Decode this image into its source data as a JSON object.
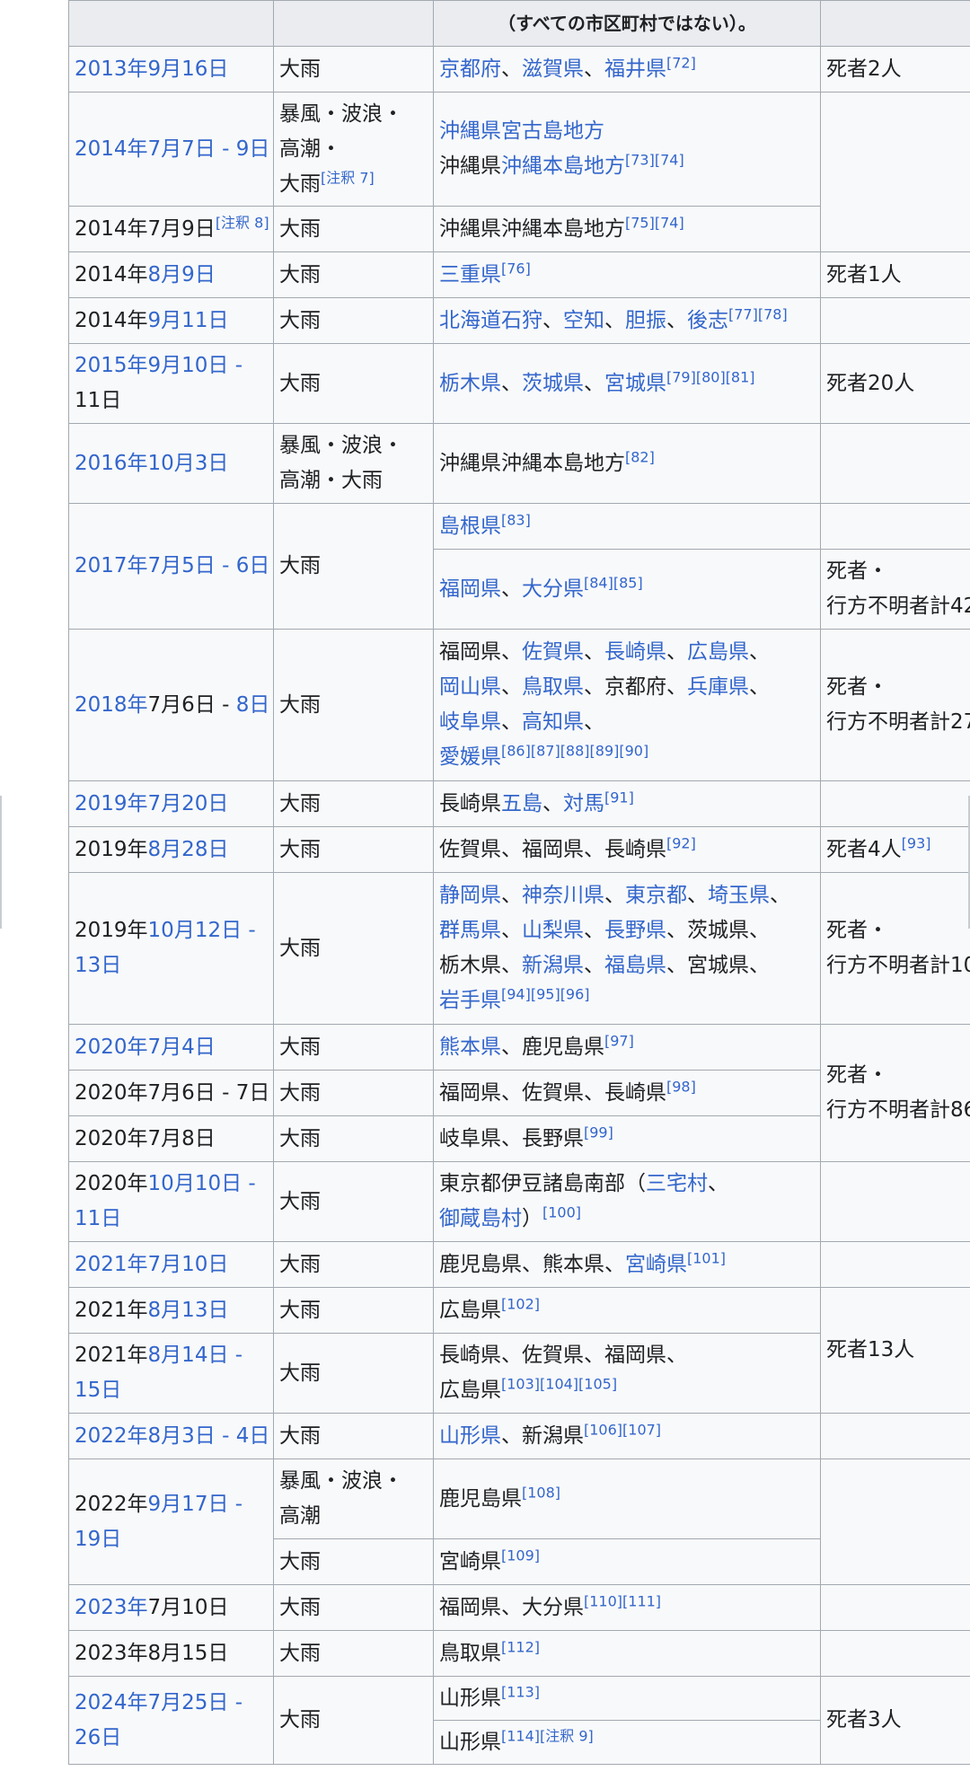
{
  "header_note": "（すべての市区町村ではない）。",
  "rows": {
    "r1": {
      "date_a": "2013年9月16日",
      "type": "大雨",
      "area_a": "京都府",
      "sep1": "、",
      "area_b": "滋賀県",
      "sep2": "、",
      "area_c": "福井県",
      "ref": "[72]",
      "damage": "死者2人"
    },
    "r2": {
      "date_a": "2014年7月7日",
      "sep": " - ",
      "date_b": "9日",
      "type_a": "暴風・波浪・",
      "type_b": "高潮・",
      "type_c": "大雨",
      "type_ref": "[注釈 7]",
      "area_a": "沖縄県宮古島地方",
      "area_b_plain": "沖縄県",
      "area_b_link": "沖縄本島地方",
      "ref": "[73][74]"
    },
    "r3": {
      "date": "2014年7月9日",
      "date_ref": "[注釈 8]",
      "type": "大雨",
      "area": "沖縄県沖縄本島地方",
      "ref": "[75][74]"
    },
    "r4": {
      "date_plain": "2014年",
      "date_link": "8月9日",
      "type": "大雨",
      "area": "三重県",
      "ref": "[76]",
      "damage": "死者1人"
    },
    "r5": {
      "date_plain": "2014年",
      "date_link": "9月11日",
      "type": "大雨",
      "area_a": "北海道石狩",
      "sep1": "、",
      "area_b": "空知",
      "sep2": "、",
      "area_c": "胆振",
      "sep3": "、",
      "area_d": "後志",
      "ref": "[77][78]"
    },
    "r6": {
      "date_a": "2015年9月10日",
      "sep": " -",
      "date_b": "11日",
      "type": "大雨",
      "area_a": "栃木県",
      "sep1": "、",
      "area_b": "茨城県",
      "sep2": "、",
      "area_c": "宮城県",
      "ref": "[79][80][81]",
      "damage": "死者20人"
    },
    "r7": {
      "date": "2016年10月3日",
      "type_a": "暴風・波浪・",
      "type_b": "高潮・大雨",
      "area": "沖縄県沖縄本島地方",
      "ref": "[82]"
    },
    "r8": {
      "date_a": "2017年7月5日",
      "sep": " - ",
      "date_b": "6日",
      "type": "大雨",
      "area1": "島根県",
      "area1_ref": "[83]",
      "area2_a": "福岡県",
      "sep1": "、",
      "area2_b": "大分県",
      "area2_ref": "[84][85]",
      "damage_a": "死者・",
      "damage_b": "行方不明者計42"
    },
    "r9": {
      "date_a": "2018年",
      "date_b": "7月6日 - ",
      "date_c": "8日",
      "type": "大雨",
      "l1_a": "福岡県",
      "l1_s1": "、",
      "l1_b": "佐賀県",
      "l1_s2": "、",
      "l1_c": "長崎県",
      "l1_s3": "、",
      "l1_d": "広島県",
      "l1_s4": "、",
      "l2_a": "岡山県",
      "l2_s1": "、",
      "l2_b": "鳥取県",
      "l2_s2": "、京都府、",
      "l2_c": "兵庫県",
      "l2_s3": "、",
      "l3_a": "岐阜県",
      "l3_s1": "、",
      "l3_b": "高知県",
      "l3_s2": "、",
      "l4_a": "愛媛県",
      "ref": "[86][87][88][89][90]",
      "damage_a": "死者・",
      "damage_b": "行方不明者計27"
    },
    "r10": {
      "date": "2019年7月20日",
      "type": "大雨",
      "area_plain": "長崎県",
      "area_a": "五島",
      "sep1": "、",
      "area_b": "対馬",
      "ref": "[91]"
    },
    "r11": {
      "date_plain": "2019年",
      "date_link": "8月28日",
      "type": "大雨",
      "area": "佐賀県、福岡県、長崎県",
      "ref": "[92]",
      "damage": "死者4人",
      "damage_ref": "[93]"
    },
    "r12": {
      "date_plain": "2019年",
      "date_link": "10月12日",
      "sep": " -",
      "date_b": "13日",
      "type": "大雨",
      "l1_a": "静岡県",
      "l1_s1": "、",
      "l1_b": "神奈川県",
      "l1_s2": "、",
      "l1_c": "東京都",
      "l1_s3": "、",
      "l1_d": "埼玉県",
      "l1_s4": "、",
      "l2_a": "群馬県",
      "l2_s1": "、",
      "l2_b": "山梨県",
      "l2_s2": "、",
      "l2_c": "長野県",
      "l2_s3": "、茨城県、",
      "l3_a": "栃木県、",
      "l3_b": "新潟県",
      "l3_s1": "、",
      "l3_c": "福島県",
      "l3_s2": "、宮城県、",
      "l4_a": "岩手県",
      "ref": "[94][95][96]",
      "damage_a": "死者・",
      "damage_b": "行方不明者計10"
    },
    "r13": {
      "date": "2020年7月4日",
      "type": "大雨",
      "area_a": "熊本県",
      "area_b": "、鹿児島県",
      "ref": "[97]",
      "damage_a": "死者・",
      "damage_b": "行方不明者計86"
    },
    "r14": {
      "date": "2020年7月6日 - 7日",
      "type": "大雨",
      "area": "福岡県、佐賀県、長崎県",
      "ref": "[98]"
    },
    "r15": {
      "date": "2020年7月8日",
      "type": "大雨",
      "area": "岐阜県、長野県",
      "ref": "[99]"
    },
    "r16": {
      "date_plain": "2020年",
      "date_link": "10月10日",
      "sep": " -",
      "date_b": "11日",
      "type": "大雨",
      "area_a": "東京都伊豆諸島南部（",
      "area_b": "三宅村",
      "sep1": "、",
      "area_c": "御蔵島村",
      "area_d": "）",
      "ref": "[100]"
    },
    "r17": {
      "date": "2021年7月10日",
      "type": "大雨",
      "area_a": "鹿児島県、熊本県、",
      "area_b": "宮崎県",
      "ref": "[101]"
    },
    "r18": {
      "date_plain": "2021年",
      "date_link": "8月13日",
      "type": "大雨",
      "area": "広島県",
      "ref": "[102]",
      "damage": "死者13人"
    },
    "r19": {
      "date_plain": "2021年",
      "date_link": "8月14日",
      "sep": " -",
      "date_b": "15日",
      "type": "大雨",
      "area_a": "長崎県、佐賀県、福岡県、",
      "area_b": "広島県",
      "ref": "[103][104][105]"
    },
    "r20": {
      "date_a": "2022年8月3日",
      "sep": " - ",
      "date_b": "4日",
      "type": "大雨",
      "area_a": "山形県",
      "area_b": "、新潟県",
      "ref": "[106][107]"
    },
    "r21": {
      "date_plain": "2022年",
      "date_link": "9月17日",
      "sep": " -",
      "date_b": "19日",
      "type1_a": "暴風・波浪・",
      "type1_b": "高潮",
      "area1": "鹿児島県",
      "area1_ref": "[108]",
      "type2": "大雨",
      "area2": "宮崎県",
      "area2_ref": "[109]"
    },
    "r22": {
      "date_link": "2023年",
      "date_plain": "7月10日",
      "type": "大雨",
      "area": "福岡県、大分県",
      "ref": "[110][111]"
    },
    "r23": {
      "date": "2023年8月15日",
      "type": "大雨",
      "area": "鳥取県",
      "ref": "[112]"
    },
    "r24": {
      "date_a": "2024年7月25日",
      "sep": " -",
      "date_b": "26日",
      "type": "大雨",
      "area1": "山形県",
      "area1_ref": "[113]",
      "area2": "山形県",
      "area2_ref": "[114][注釈 9]",
      "damage": "死者3人"
    }
  }
}
